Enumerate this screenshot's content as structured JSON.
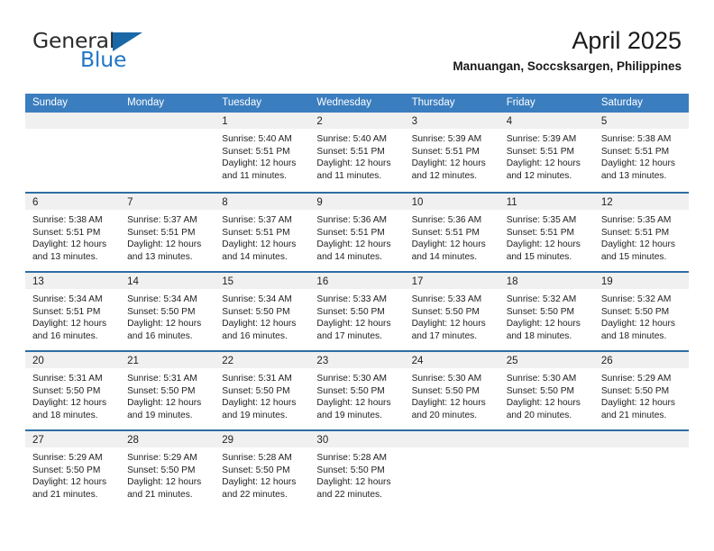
{
  "brand": {
    "name_top": "General",
    "name_bottom": "Blue",
    "accent_color": "#2176c7",
    "flag_color": "#1b68a8"
  },
  "header": {
    "title": "April 2025",
    "subtitle": "Manuangan, Soccsksargen, Philippines"
  },
  "theme": {
    "header_band": "#3b7ebf",
    "row_divider": "#2e6da4",
    "day_strip": "#f0f0f0"
  },
  "weekdays": [
    "Sunday",
    "Monday",
    "Tuesday",
    "Wednesday",
    "Thursday",
    "Friday",
    "Saturday"
  ],
  "weeks": [
    [
      {
        "day": "",
        "lines": []
      },
      {
        "day": "",
        "lines": []
      },
      {
        "day": "1",
        "lines": [
          "Sunrise: 5:40 AM",
          "Sunset: 5:51 PM",
          "Daylight: 12 hours",
          "and 11 minutes."
        ]
      },
      {
        "day": "2",
        "lines": [
          "Sunrise: 5:40 AM",
          "Sunset: 5:51 PM",
          "Daylight: 12 hours",
          "and 11 minutes."
        ]
      },
      {
        "day": "3",
        "lines": [
          "Sunrise: 5:39 AM",
          "Sunset: 5:51 PM",
          "Daylight: 12 hours",
          "and 12 minutes."
        ]
      },
      {
        "day": "4",
        "lines": [
          "Sunrise: 5:39 AM",
          "Sunset: 5:51 PM",
          "Daylight: 12 hours",
          "and 12 minutes."
        ]
      },
      {
        "day": "5",
        "lines": [
          "Sunrise: 5:38 AM",
          "Sunset: 5:51 PM",
          "Daylight: 12 hours",
          "and 13 minutes."
        ]
      }
    ],
    [
      {
        "day": "6",
        "lines": [
          "Sunrise: 5:38 AM",
          "Sunset: 5:51 PM",
          "Daylight: 12 hours",
          "and 13 minutes."
        ]
      },
      {
        "day": "7",
        "lines": [
          "Sunrise: 5:37 AM",
          "Sunset: 5:51 PM",
          "Daylight: 12 hours",
          "and 13 minutes."
        ]
      },
      {
        "day": "8",
        "lines": [
          "Sunrise: 5:37 AM",
          "Sunset: 5:51 PM",
          "Daylight: 12 hours",
          "and 14 minutes."
        ]
      },
      {
        "day": "9",
        "lines": [
          "Sunrise: 5:36 AM",
          "Sunset: 5:51 PM",
          "Daylight: 12 hours",
          "and 14 minutes."
        ]
      },
      {
        "day": "10",
        "lines": [
          "Sunrise: 5:36 AM",
          "Sunset: 5:51 PM",
          "Daylight: 12 hours",
          "and 14 minutes."
        ]
      },
      {
        "day": "11",
        "lines": [
          "Sunrise: 5:35 AM",
          "Sunset: 5:51 PM",
          "Daylight: 12 hours",
          "and 15 minutes."
        ]
      },
      {
        "day": "12",
        "lines": [
          "Sunrise: 5:35 AM",
          "Sunset: 5:51 PM",
          "Daylight: 12 hours",
          "and 15 minutes."
        ]
      }
    ],
    [
      {
        "day": "13",
        "lines": [
          "Sunrise: 5:34 AM",
          "Sunset: 5:51 PM",
          "Daylight: 12 hours",
          "and 16 minutes."
        ]
      },
      {
        "day": "14",
        "lines": [
          "Sunrise: 5:34 AM",
          "Sunset: 5:50 PM",
          "Daylight: 12 hours",
          "and 16 minutes."
        ]
      },
      {
        "day": "15",
        "lines": [
          "Sunrise: 5:34 AM",
          "Sunset: 5:50 PM",
          "Daylight: 12 hours",
          "and 16 minutes."
        ]
      },
      {
        "day": "16",
        "lines": [
          "Sunrise: 5:33 AM",
          "Sunset: 5:50 PM",
          "Daylight: 12 hours",
          "and 17 minutes."
        ]
      },
      {
        "day": "17",
        "lines": [
          "Sunrise: 5:33 AM",
          "Sunset: 5:50 PM",
          "Daylight: 12 hours",
          "and 17 minutes."
        ]
      },
      {
        "day": "18",
        "lines": [
          "Sunrise: 5:32 AM",
          "Sunset: 5:50 PM",
          "Daylight: 12 hours",
          "and 18 minutes."
        ]
      },
      {
        "day": "19",
        "lines": [
          "Sunrise: 5:32 AM",
          "Sunset: 5:50 PM",
          "Daylight: 12 hours",
          "and 18 minutes."
        ]
      }
    ],
    [
      {
        "day": "20",
        "lines": [
          "Sunrise: 5:31 AM",
          "Sunset: 5:50 PM",
          "Daylight: 12 hours",
          "and 18 minutes."
        ]
      },
      {
        "day": "21",
        "lines": [
          "Sunrise: 5:31 AM",
          "Sunset: 5:50 PM",
          "Daylight: 12 hours",
          "and 19 minutes."
        ]
      },
      {
        "day": "22",
        "lines": [
          "Sunrise: 5:31 AM",
          "Sunset: 5:50 PM",
          "Daylight: 12 hours",
          "and 19 minutes."
        ]
      },
      {
        "day": "23",
        "lines": [
          "Sunrise: 5:30 AM",
          "Sunset: 5:50 PM",
          "Daylight: 12 hours",
          "and 19 minutes."
        ]
      },
      {
        "day": "24",
        "lines": [
          "Sunrise: 5:30 AM",
          "Sunset: 5:50 PM",
          "Daylight: 12 hours",
          "and 20 minutes."
        ]
      },
      {
        "day": "25",
        "lines": [
          "Sunrise: 5:30 AM",
          "Sunset: 5:50 PM",
          "Daylight: 12 hours",
          "and 20 minutes."
        ]
      },
      {
        "day": "26",
        "lines": [
          "Sunrise: 5:29 AM",
          "Sunset: 5:50 PM",
          "Daylight: 12 hours",
          "and 21 minutes."
        ]
      }
    ],
    [
      {
        "day": "27",
        "lines": [
          "Sunrise: 5:29 AM",
          "Sunset: 5:50 PM",
          "Daylight: 12 hours",
          "and 21 minutes."
        ]
      },
      {
        "day": "28",
        "lines": [
          "Sunrise: 5:29 AM",
          "Sunset: 5:50 PM",
          "Daylight: 12 hours",
          "and 21 minutes."
        ]
      },
      {
        "day": "29",
        "lines": [
          "Sunrise: 5:28 AM",
          "Sunset: 5:50 PM",
          "Daylight: 12 hours",
          "and 22 minutes."
        ]
      },
      {
        "day": "30",
        "lines": [
          "Sunrise: 5:28 AM",
          "Sunset: 5:50 PM",
          "Daylight: 12 hours",
          "and 22 minutes."
        ]
      },
      {
        "day": "",
        "lines": []
      },
      {
        "day": "",
        "lines": []
      },
      {
        "day": "",
        "lines": []
      }
    ]
  ]
}
